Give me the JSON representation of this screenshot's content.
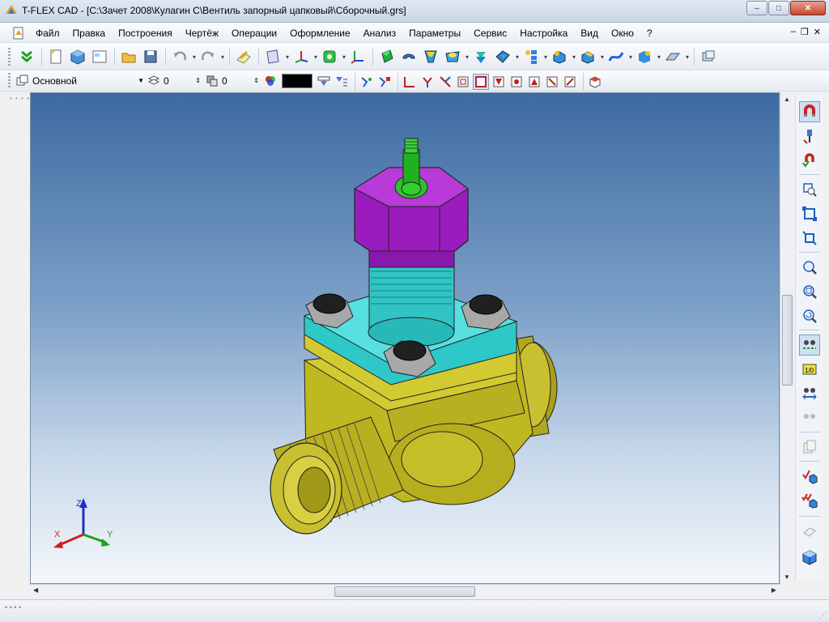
{
  "window": {
    "title": "T-FLEX CAD - [C:\\Зачет 2008\\Кулагин С\\Вентиль запорный цапковый\\Сборочный.grs]",
    "minimize": "–",
    "maximize": "□",
    "close": "✕"
  },
  "menu": {
    "items": [
      "Файл",
      "Правка",
      "Построения",
      "Чертёж",
      "Операции",
      "Оформление",
      "Анализ",
      "Параметры",
      "Сервис",
      "Настройка",
      "Вид",
      "Окно",
      "?"
    ],
    "mdi_minimize": "–",
    "mdi_restore": "❐",
    "mdi_close": "✕"
  },
  "toolbar2": {
    "layer_combo": "Основной",
    "level_value": "0",
    "priority_value": "0",
    "color_value": "#000000"
  },
  "axes": {
    "x_label": "X",
    "y_label": "Y",
    "z_label": "Z"
  },
  "colors": {
    "body": "#c8c020",
    "bonnet": "#30c8c8",
    "nut": "#a020c8",
    "stem": "#20c020",
    "bolts": "#a0a0a0"
  }
}
